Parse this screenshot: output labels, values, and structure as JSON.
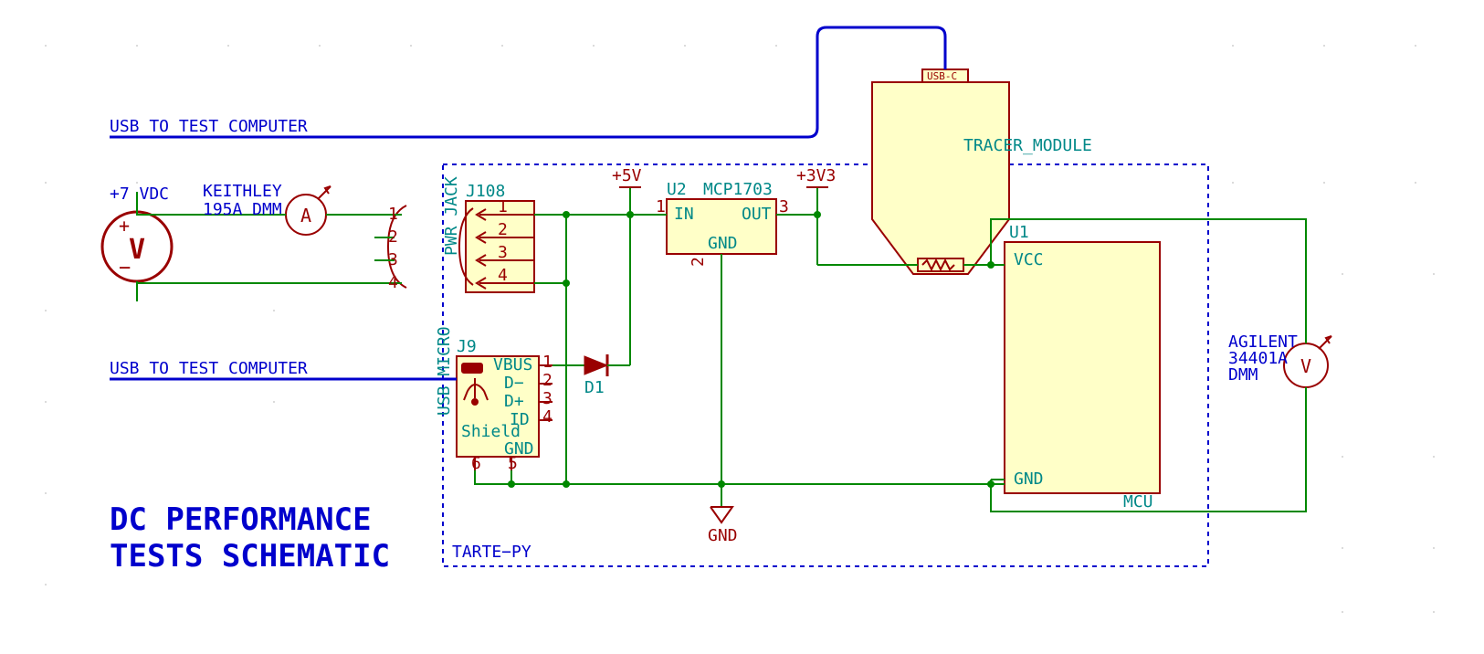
{
  "title_line1": "DC PERFORMANCE",
  "title_line2": "TESTS SCHEMATIC",
  "source": {
    "voltage": "+7 VDC",
    "glyph": "V",
    "plus": "+",
    "minus": "−"
  },
  "ammeter": {
    "label_l1": "KEITHLEY",
    "label_l2": "195A DMM",
    "glyph": "A"
  },
  "voltmeter": {
    "label_l1": "AGILENT",
    "label_l2": "34401A",
    "label_l3": "DMM",
    "glyph": "V"
  },
  "usb_note1": "USB TO TEST COMPUTER",
  "usb_note2": "USB TO TEST COMPUTER",
  "pwr_conn": {
    "ref": "J108",
    "side_label": "PWR JACK",
    "pins_left": [
      "1",
      "2",
      "3",
      "4"
    ],
    "pins_right": [
      "1",
      "2",
      "3",
      "4"
    ]
  },
  "usb_micro": {
    "ref": "J9",
    "side_label": "USB MICRO",
    "pin_labels": [
      "VBUS",
      "D−",
      "D+",
      "ID"
    ],
    "pin_nums": [
      "1",
      "2",
      "3",
      "4"
    ],
    "shield": "Shield",
    "gnd": "GND",
    "shield_num": "6",
    "gnd_num": "5"
  },
  "diode": {
    "ref": "D1"
  },
  "reg": {
    "ref": "U2",
    "part": "MCP1703",
    "in": {
      "name": "IN",
      "num": "1"
    },
    "out": {
      "name": "OUT",
      "num": "3"
    },
    "gnd": {
      "name": "GND",
      "num": "2"
    }
  },
  "rails": {
    "v5": "+5V",
    "v3": "+3V3",
    "gnd": "GND"
  },
  "mcu": {
    "ref": "U1",
    "vcc": "VCC",
    "gnd": "GND",
    "foot": "MCU"
  },
  "tracer": {
    "label": "TRACER_MODULE",
    "usb": "USB-C"
  },
  "board": {
    "name": "TARTE−PY"
  }
}
